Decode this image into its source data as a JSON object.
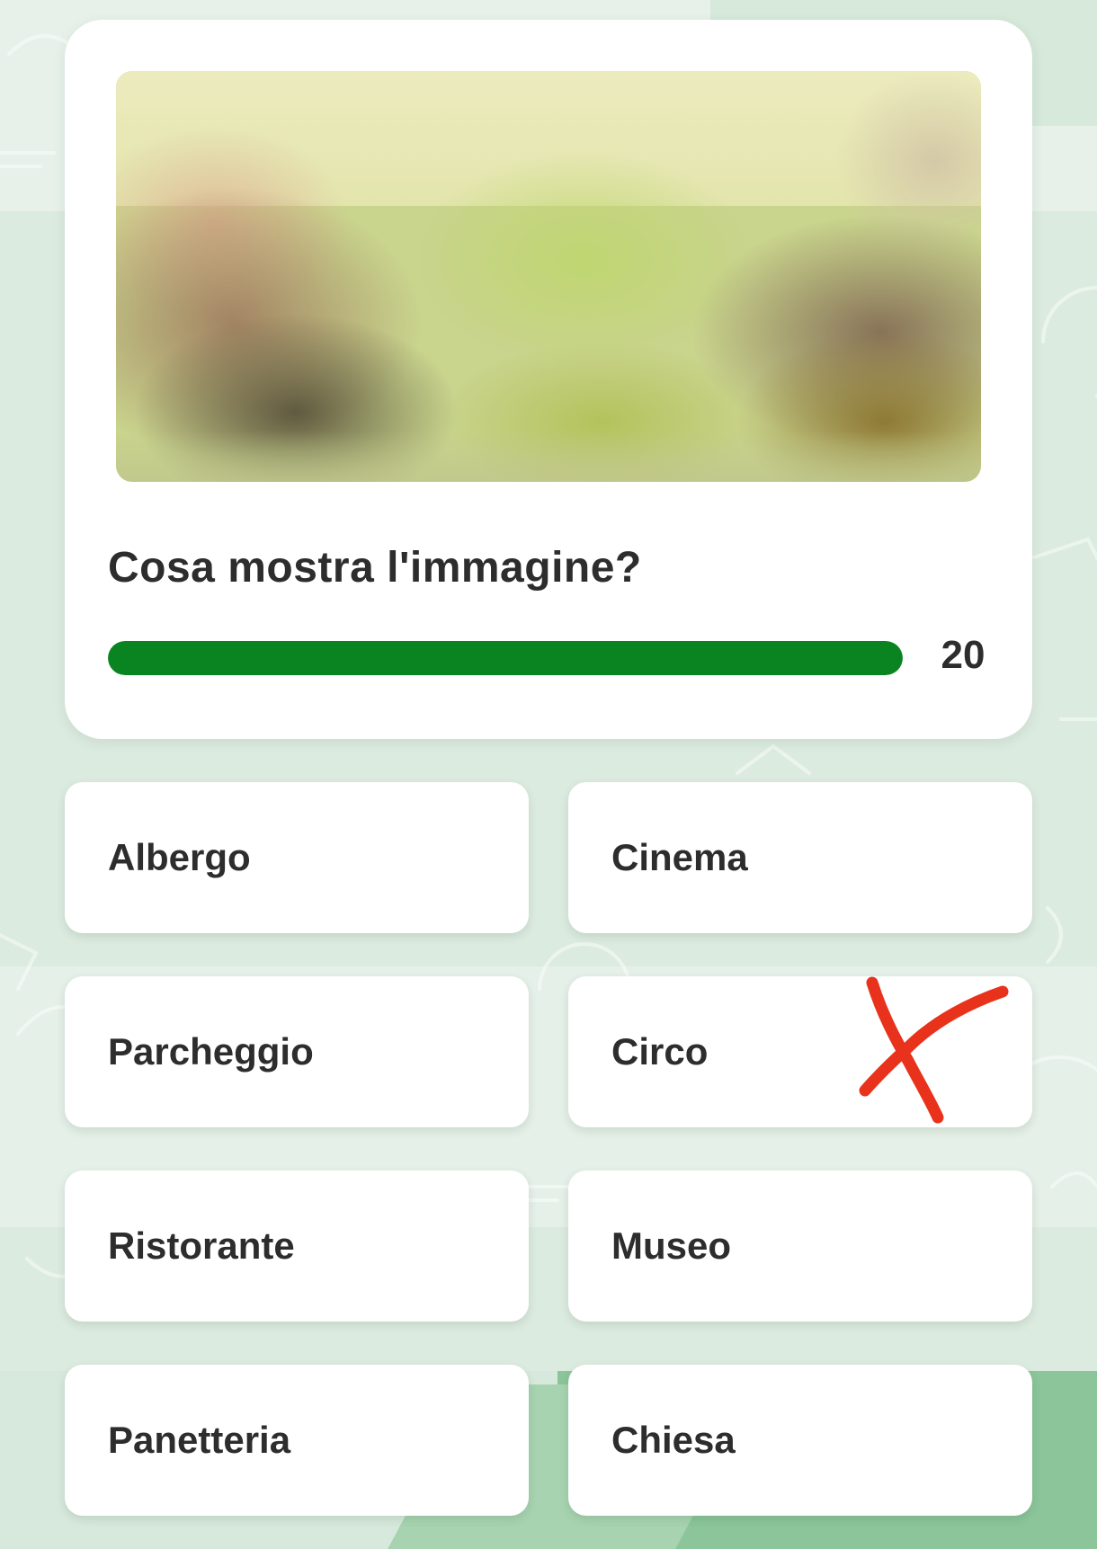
{
  "quiz": {
    "question": "Cosa mostra l'immagine?",
    "image_icon": "blurred-photo",
    "timer": {
      "count": "20",
      "progress": 1.0,
      "color": "#0a8420"
    },
    "answers": [
      {
        "label": "Albergo"
      },
      {
        "label": "Cinema"
      },
      {
        "label": "Parcheggio"
      },
      {
        "label": "Circo"
      },
      {
        "label": "Ristorante"
      },
      {
        "label": "Museo"
      },
      {
        "label": "Panetteria"
      },
      {
        "label": "Chiesa"
      }
    ]
  },
  "annotation": {
    "icon": "red-x-mark",
    "color": "#e8321c",
    "target_answer": "Circo"
  }
}
